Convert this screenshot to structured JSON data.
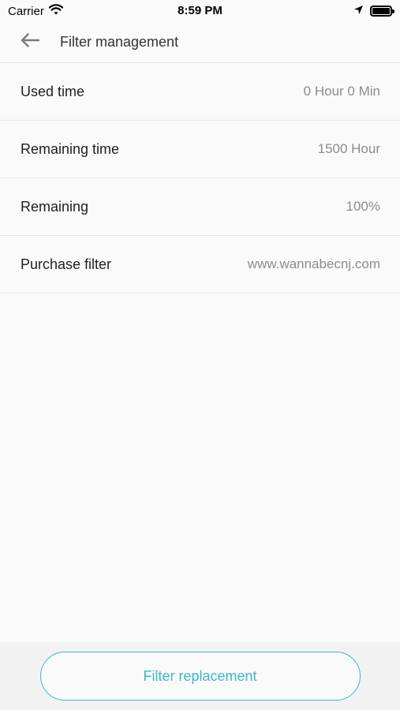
{
  "status_bar": {
    "carrier": "Carrier",
    "time": "8:59 PM"
  },
  "header": {
    "title": "Filter management",
    "back_icon": "arrow-left-icon"
  },
  "rows": [
    {
      "label": "Used time",
      "value": "0 Hour 0 Min"
    },
    {
      "label": "Remaining time",
      "value": "1500 Hour"
    },
    {
      "label": "Remaining",
      "value": "100%"
    },
    {
      "label": "Purchase filter",
      "value": "www.wannabecnj.com"
    }
  ],
  "footer": {
    "button_label": "Filter replacement"
  },
  "colors": {
    "accent": "#3cb8c8",
    "background": "#fafafa",
    "divider": "#e6e6e6",
    "value_text": "#8c8c8c"
  }
}
